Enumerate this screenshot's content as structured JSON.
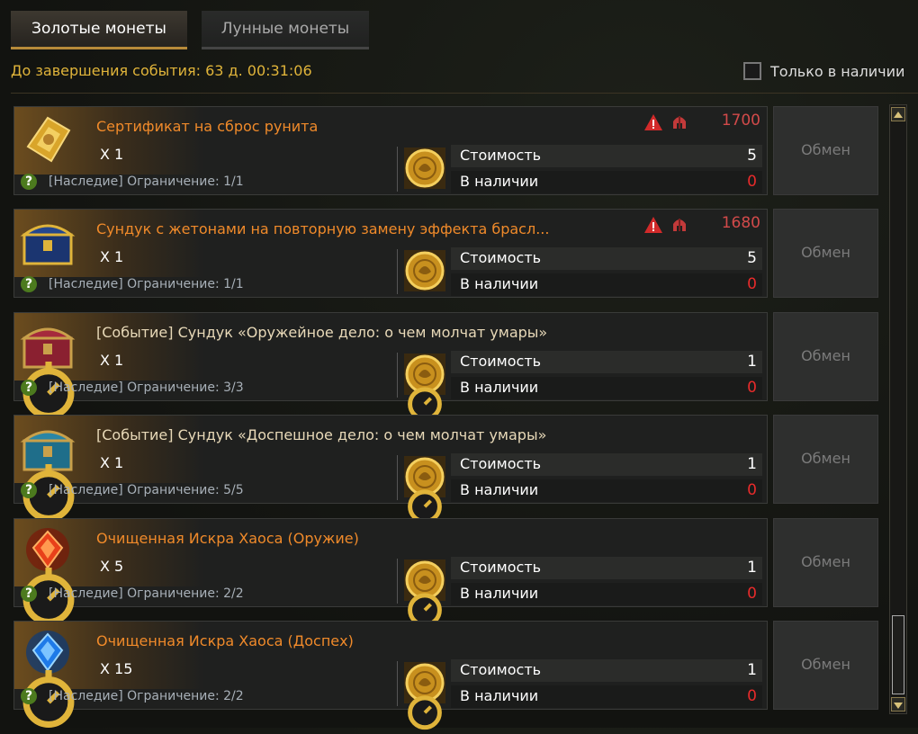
{
  "tabs": {
    "gold": "Золотые монеты",
    "moon": "Лунные монеты"
  },
  "timer": "До завершения события: 63 д. 00:31:06",
  "filter_label": "Только в наличии",
  "labels": {
    "cost": "Стоимость",
    "stock": "В наличии",
    "exchange": "Обмен"
  },
  "items": [
    {
      "title": "Сертификат на сброс рунита",
      "qty": "X 1",
      "limit": "[Наследие] Ограничение: 1/1",
      "cost": "5",
      "stock": "0",
      "price": "1700",
      "icon": "golden-certificate-icon"
    },
    {
      "title": "Сундук с жетонами на повторную замену эффекта брасл...",
      "qty": "X 1",
      "limit": "[Наследие] Ограничение: 1/1",
      "cost": "5",
      "stock": "0",
      "price": "1680",
      "icon": "golden-chest-icon"
    },
    {
      "title": "[Событие] Сундук «Оружейное дело: о чем молчат умары»",
      "qty": "X 1",
      "limit": "[Наследие] Ограничение: 3/3",
      "cost": "1",
      "stock": "0",
      "icon": "red-chest-icon"
    },
    {
      "title": "[Событие] Сундук «Доспешное дело: о чем молчат умары»",
      "qty": "X 1",
      "limit": "[Наследие] Ограничение: 5/5",
      "cost": "1",
      "stock": "0",
      "icon": "blue-chest-icon"
    },
    {
      "title": "Очищенная Искра Хаоса (Оружие)",
      "qty": "X 5",
      "limit": "[Наследие] Ограничение: 2/2",
      "cost": "1",
      "stock": "0",
      "icon": "red-spark-icon"
    },
    {
      "title": "Очищенная Искра Хаоса (Доспех)",
      "qty": "X 15",
      "limit": "[Наследие] Ограничение: 2/2",
      "cost": "1",
      "stock": "0",
      "icon": "blue-spark-icon"
    }
  ],
  "colors": {
    "accent_gold": "#e0b43a",
    "title_orange": "#f08a2a",
    "stock_red": "#e82b2b",
    "price_red": "#d24a4a"
  }
}
